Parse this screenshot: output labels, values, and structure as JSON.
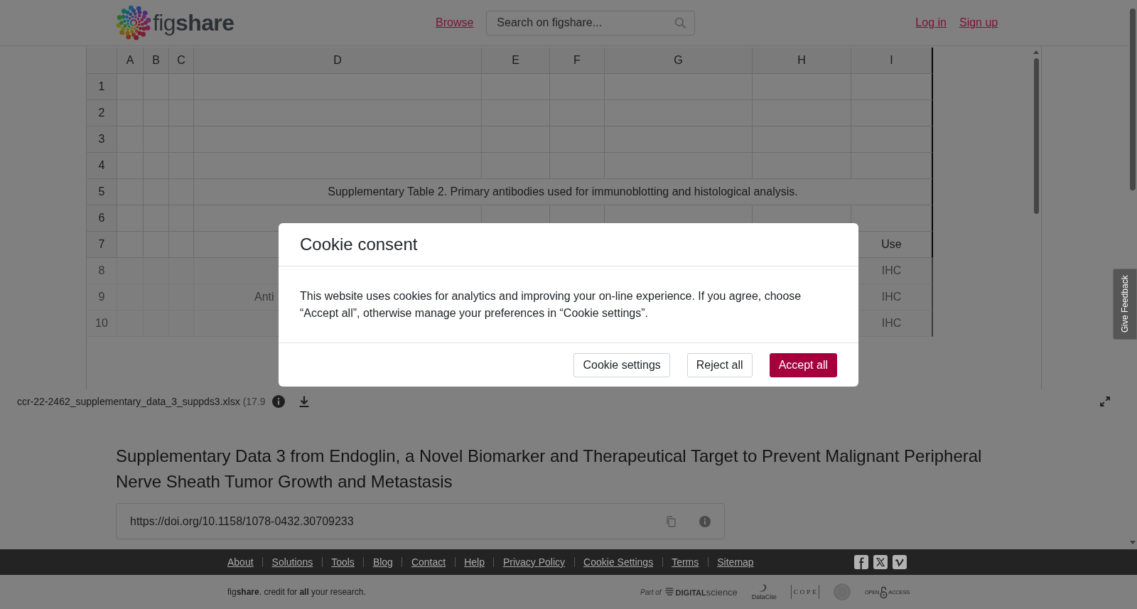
{
  "header": {
    "logo": "fig**share**",
    "nav_link": "Browse",
    "search": {
      "placeholder": "Search on figshare..."
    },
    "auth_links": [
      "Log in",
      "Sign up"
    ]
  },
  "spreadsheet": {
    "columns": [
      "A",
      "B",
      "C",
      "D",
      "E",
      "F",
      "G",
      "H",
      "I"
    ],
    "rows": [
      {
        "number": "1",
        "faded": false
      },
      {
        "number": "2",
        "faded": false
      },
      {
        "number": "3",
        "faded": false
      },
      {
        "number": "4",
        "faded": false
      },
      {
        "number": "5",
        "faded": false,
        "title": "Supplementary Table 2. Primary antibodies used for immunoblotting and histological analysis."
      },
      {
        "number": "6",
        "faded": false
      },
      {
        "number": "7",
        "faded": false,
        "col_i": "Use"
      },
      {
        "number": "8",
        "faded": true,
        "col_i": "IHC"
      },
      {
        "number": "9",
        "faded": true,
        "col_d": "Anti",
        "col_i": "IHC"
      },
      {
        "number": "10",
        "faded": true,
        "col_i": "IHC"
      }
    ]
  },
  "file_bar": {
    "file_name": "ccr-22-2462_supplementary_data_3_suppds3.xlsx",
    "file_size": "(17.9"
  },
  "item": {
    "title": "Supplementary Data 3 from Endoglin, a Novel Biomarker and Therapeutical Target to Prevent Malignant Peripheral Nerve Sheath Tumor Growth and Metastasis",
    "doi": "https://doi.org/10.1158/1078-0432.30709233"
  },
  "feedback_tab": "Give Feedback",
  "cookie_dialog": {
    "title": "Cookie consent",
    "message": "This website uses cookies for analytics and improving your on-line experience. If you agree, choose “Accept all”, otherwise manage your preferences in “Cookie settings”.",
    "buttons": [
      {
        "label": "Cookie settings",
        "kind": "outline"
      },
      {
        "label": "Reject all",
        "kind": "outline"
      },
      {
        "label": "Accept all",
        "kind": "primary"
      }
    ]
  },
  "footer": {
    "links": [
      "About",
      "Solutions",
      "Tools",
      "Blog",
      "Contact",
      "Help",
      "Privacy Policy",
      "Cookie Settings",
      "Terms",
      "Sitemap"
    ],
    "tagline": "fig**share**. credit for **all** your research.",
    "partner_logos": [
      {
        "kind": "digital_science",
        "caption": "Part of",
        "wordmark": "**DIGITAL**science"
      },
      {
        "kind": "datacite",
        "wordmark": "DataCite"
      },
      {
        "kind": "cope",
        "wordmark": "COPE"
      },
      {
        "kind": "seal"
      },
      {
        "kind": "open_access",
        "words": [
          "OPEN",
          "ACCESS"
        ]
      }
    ]
  }
}
